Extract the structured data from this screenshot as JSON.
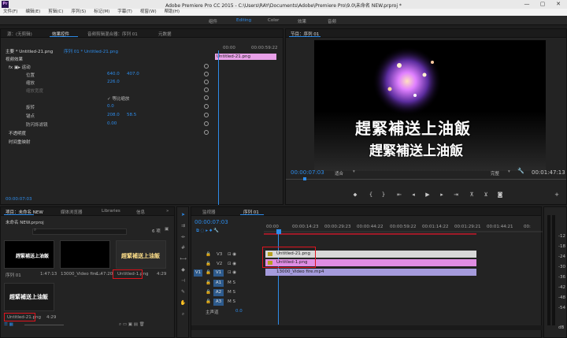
{
  "window": {
    "title": "Adobe Premiere Pro CC 2015 - C:\\Users\\RAY\\Documents\\Adobe\\Premiere Pro\\9.0\\未命名 NEW.prproj *",
    "minimize": "—",
    "maximize": "▢",
    "close": "✕"
  },
  "menu": [
    "文件(F)",
    "编辑(E)",
    "剪辑(C)",
    "序列(S)",
    "标记(M)",
    "字幕(T)",
    "视窗(W)",
    "帮助(H)"
  ],
  "workspaces": [
    "组件",
    "Editing",
    "Color",
    "效果",
    "音频"
  ],
  "effects_panel": {
    "tabs": [
      "源：(无剪辑)",
      "效果控件",
      "音频剪辑混合器：序列 01",
      "元数据"
    ],
    "master": "主要 * Untitled-21.png",
    "sequence": "序列 01 * Untitled-21.png",
    "timecode_start": "00:00",
    "timecode_end": "00:00:59:22",
    "clip_label": "Untitled-21.png",
    "section": "视频效果",
    "motion": "fx  ▣▸ 运动",
    "props": [
      {
        "name": "位置",
        "v1": "640.0",
        "v2": "407.0"
      },
      {
        "name": "缩放",
        "v1": "226.0",
        "v2": ""
      },
      {
        "name": "缩放宽度",
        "v1": "",
        "v2": ""
      },
      {
        "name": "等比缩放",
        "v1": "",
        "v2": ""
      },
      {
        "name": "旋转",
        "v1": "0.0",
        "v2": ""
      },
      {
        "name": "锚点",
        "v1": "208.0",
        "v2": "58.5"
      },
      {
        "name": "防闪烁滤镜",
        "v1": "0.00",
        "v2": ""
      }
    ],
    "opacity": "不透明度",
    "timeremap": "时间重映射",
    "footer_tc": "00:00:07:03"
  },
  "program": {
    "tab": "节目：序列 01",
    "line1": "趕緊補送上油飯",
    "line2": "趕緊補送上油飯",
    "timecode": "00:00:07:03",
    "fit": "适合",
    "quality": "完整",
    "duration": "00:01:47:13"
  },
  "project": {
    "tabs": [
      "项目：未命名 NEW",
      "媒体浏览器",
      "Libraries",
      "信息"
    ],
    "file": "未命名 NEW.prproj",
    "count": "6 项",
    "items": [
      {
        "name": "序列 01",
        "dur": "1:47:13"
      },
      {
        "name": "13000_Video fire...",
        "dur": "1:47:20"
      },
      {
        "name": "Untitled-1.png",
        "dur": "4:29"
      },
      {
        "name": "Untitled-21.png",
        "dur": "4:29"
      }
    ],
    "thumb_text": "趕緊補送上油飯"
  },
  "timeline": {
    "tabs": [
      "监视器",
      "序列 01"
    ],
    "timecode": "00:00:07:03",
    "ruler": [
      "00:00",
      "00:00:14:23",
      "00:00:29:23",
      "00:00:44:22",
      "00:00:59:22",
      "00:01:14:22",
      "00:01:29:21",
      "00:01:44:21",
      "00:"
    ],
    "tracks": [
      "V3",
      "V2",
      "V1",
      "A1",
      "A2",
      "A3"
    ],
    "v1_source": "V1",
    "master": "主声道",
    "master_val": "0.0",
    "clips": [
      {
        "label": "Untitled-21.png",
        "color": "#d8d8d8"
      },
      {
        "label": "Untitled-1.png",
        "color": "#e08de3"
      },
      {
        "label": "13000_Video fire.mp4",
        "color": "#a59bdc"
      }
    ],
    "meter": [
      "-12",
      "-18",
      "-24",
      "-30",
      "-36",
      "-42",
      "-48",
      "-54",
      "dB"
    ]
  }
}
